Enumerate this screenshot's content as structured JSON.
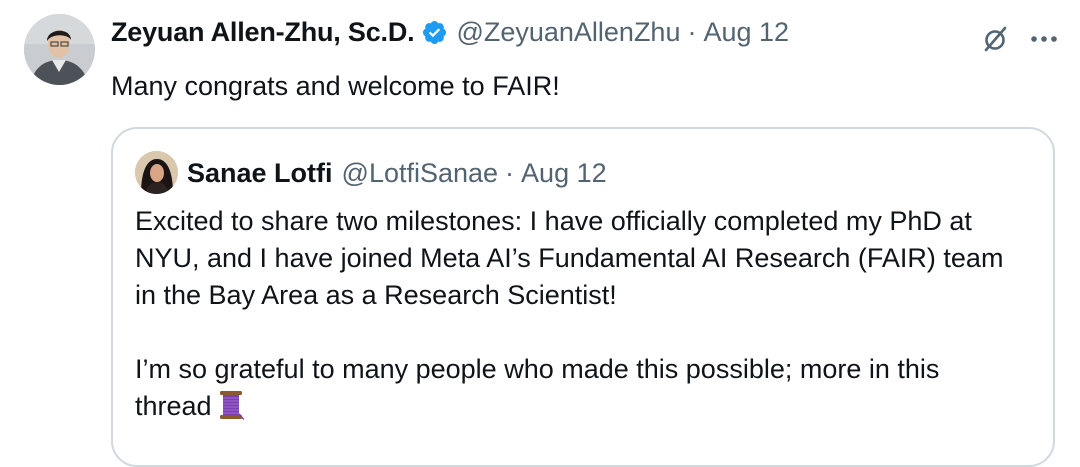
{
  "tweet": {
    "author": {
      "name": "Zeyuan Allen-Zhu, Sc.D.",
      "handle": "@ZeyuanAllenZhu",
      "verified_icon": "verified-badge-icon"
    },
    "separator": "·",
    "date": "Aug 12",
    "text": "Many congrats and welcome to FAIR!",
    "actions": {
      "grok_icon": "grok-icon",
      "more_icon": "more-options-icon"
    }
  },
  "quoted_tweet": {
    "author": {
      "name": "Sanae Lotfi",
      "handle": "@LotfiSanae"
    },
    "separator": "·",
    "date": "Aug 12",
    "lines": [
      "Excited to share two milestones: I have officially completed my PhD at",
      "NYU, and I have joined Meta AI’s Fundamental AI Research (FAIR) team",
      "in the Bay Area as a Research Scientist!",
      "I’m so grateful to many people who made this possible; more in this",
      "thread"
    ],
    "trailing_emoji": "spool-of-thread-icon"
  },
  "colors": {
    "text_primary": "#0f1419",
    "text_secondary": "#536471",
    "verified_blue": "#1d9bf0",
    "border": "#cfd9de"
  }
}
